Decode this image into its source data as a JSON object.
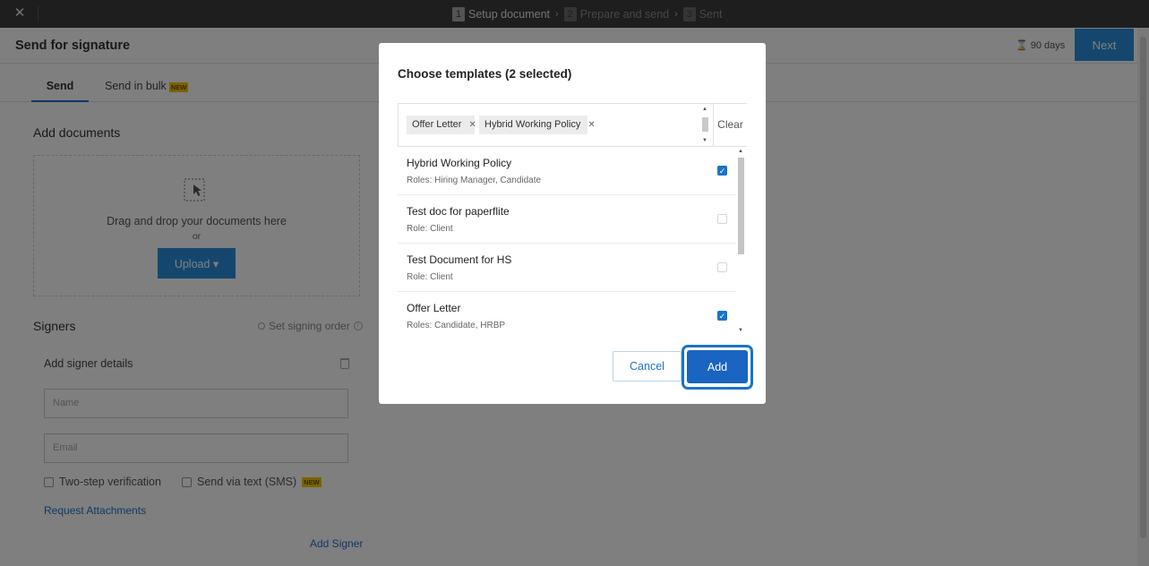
{
  "topbar": {
    "steps": [
      {
        "num": "1",
        "label": "Setup document"
      },
      {
        "num": "2",
        "label": "Prepare and send"
      },
      {
        "num": "3",
        "label": "Sent"
      }
    ]
  },
  "header": {
    "title": "Send for signature",
    "expiry": "90 days",
    "next_label": "Next"
  },
  "tabs": [
    {
      "label": "Send"
    },
    {
      "label": "Send in bulk",
      "badge": "NEW"
    }
  ],
  "documents": {
    "section_title": "Add documents",
    "drop_text": "Drag and drop your documents here",
    "or_text": "or",
    "upload_label": "Upload ▾"
  },
  "signers": {
    "section_title": "Signers",
    "signing_order_label": "Set signing order",
    "card_title": "Add signer details",
    "name_placeholder": "Name",
    "email_placeholder": "Email",
    "two_step_label": "Two-step verification",
    "sms_label": "Send via text (SMS)",
    "sms_badge": "NEW",
    "request_attachments": "Request Attachments",
    "add_signer": "Add Signer"
  },
  "modal": {
    "title": "Choose templates (2 selected)",
    "chips": [
      {
        "label": "Offer Letter"
      },
      {
        "label": "Hybrid Working Policy"
      }
    ],
    "clear_label": "Clear",
    "templates": [
      {
        "name": "Hybrid Working Policy",
        "roles": "Roles: Hiring Manager, Candidate",
        "checked": true
      },
      {
        "name": "Test doc for paperflite",
        "roles": "Role: Client",
        "checked": false
      },
      {
        "name": "Test Document for HS",
        "roles": "Role: Client",
        "checked": false
      },
      {
        "name": "Offer Letter",
        "roles": "Roles: Candidate, HRBP",
        "checked": true
      }
    ],
    "cancel_label": "Cancel",
    "add_label": "Add"
  },
  "colors": {
    "accent": "#1a73c9",
    "topbar": "#3c3c3c",
    "overlay": "rgba(0,0,0,0.5)"
  }
}
